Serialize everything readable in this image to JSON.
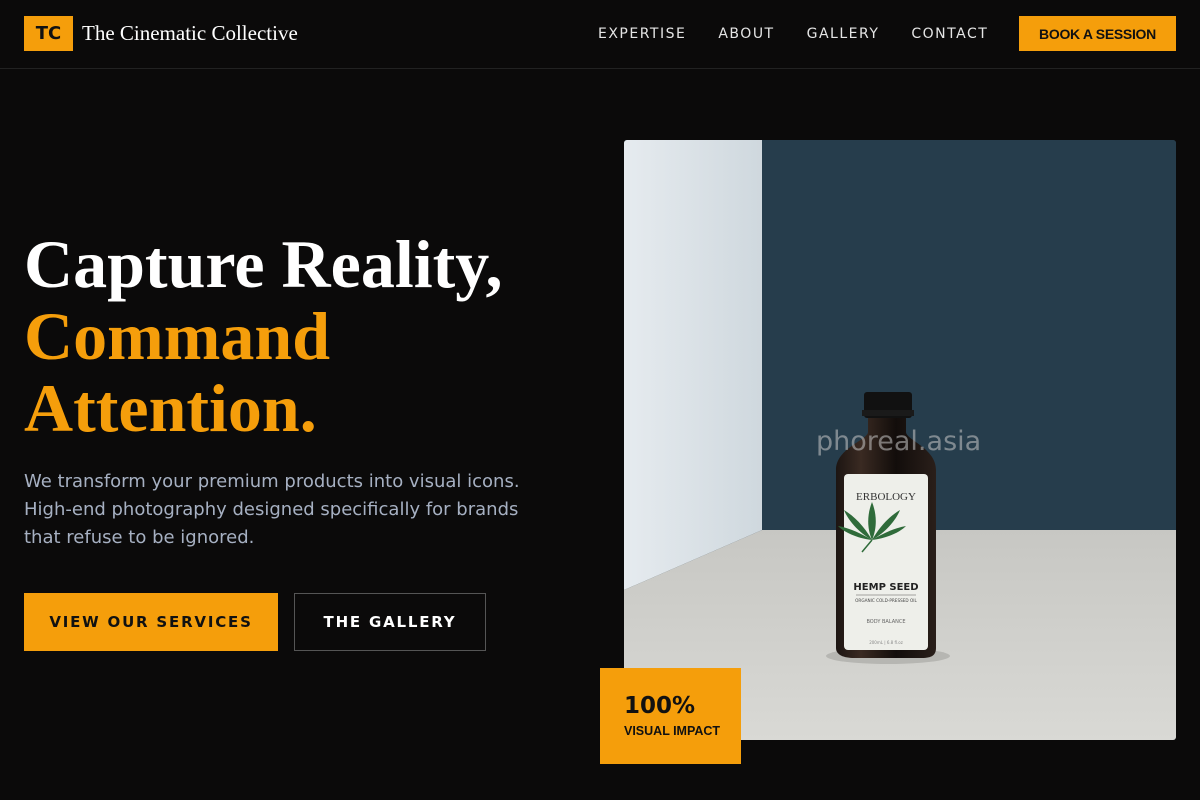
{
  "brand": {
    "mark": "TC",
    "name": "The Cinematic Collective"
  },
  "nav": {
    "items": [
      {
        "label": "EXPERTISE"
      },
      {
        "label": "ABOUT"
      },
      {
        "label": "GALLERY"
      },
      {
        "label": "CONTACT"
      }
    ],
    "cta_label": "BOOK A SESSION"
  },
  "hero": {
    "headline_line1": "Capture Reality,",
    "headline_line2": "Command",
    "headline_line3": "Attention.",
    "subtext": "We transform your premium products into visual icons. High-end photography designed specifically for brands that refuse to be ignored.",
    "primary_button": "VIEW OUR SERVICES",
    "secondary_button": "THE GALLERY"
  },
  "photo": {
    "watermark": "phoreal.asia",
    "label_brand": "ERBOLOGY",
    "label_product": "HEMP SEED",
    "label_sub": "ORGANIC COLD-PRESSED OIL",
    "label_tag": "BODY BALANCE",
    "label_volume": "200mL  |  6.8 fl.oz"
  },
  "stat": {
    "value": "100%",
    "label": "VISUAL IMPACT"
  },
  "colors": {
    "accent": "#f59e0b",
    "background": "#0b0a0a",
    "muted_text": "#a6b0c2"
  }
}
